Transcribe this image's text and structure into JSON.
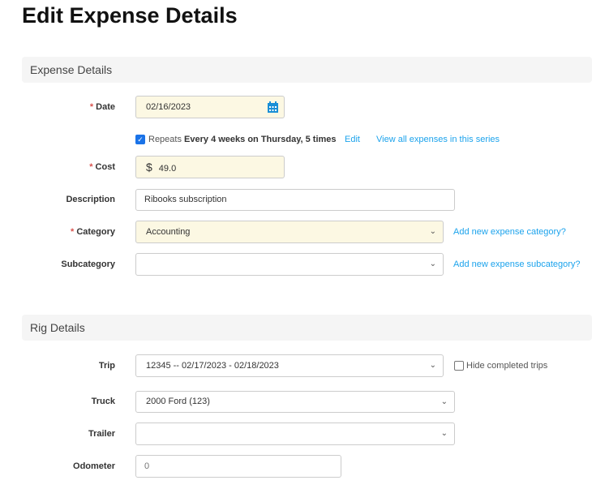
{
  "page_title": "Edit Expense Details",
  "expense_section": {
    "title": "Expense Details",
    "date": {
      "label": "Date",
      "value": "02/16/2023"
    },
    "repeat": {
      "checked": true,
      "prefix": "Repeats",
      "rule": "Every 4 weeks on Thursday, 5 times",
      "edit_link": "Edit",
      "view_link": "View all expenses in this series"
    },
    "cost": {
      "label": "Cost",
      "currency": "$",
      "value": "49.0"
    },
    "description": {
      "label": "Description",
      "value": "Ribooks subscription"
    },
    "category": {
      "label": "Category",
      "value": "Accounting",
      "add_link": "Add new expense category?"
    },
    "subcategory": {
      "label": "Subcategory",
      "value": "",
      "add_link": "Add new expense subcategory?"
    }
  },
  "rig_section": {
    "title": "Rig Details",
    "trip": {
      "label": "Trip",
      "value": "12345 -- 02/17/2023 - 02/18/2023",
      "hide_completed": {
        "label": "Hide completed trips",
        "checked": false
      }
    },
    "truck": {
      "label": "Truck",
      "value": "2000 Ford (123)"
    },
    "trailer": {
      "label": "Trailer",
      "value": ""
    },
    "odometer": {
      "label": "Odometer",
      "placeholder": "0"
    }
  },
  "required_marker": "*",
  "colors": {
    "required": "#d9534f",
    "link": "#1ca3ec",
    "required_field_bg": "#fcf8e3"
  }
}
